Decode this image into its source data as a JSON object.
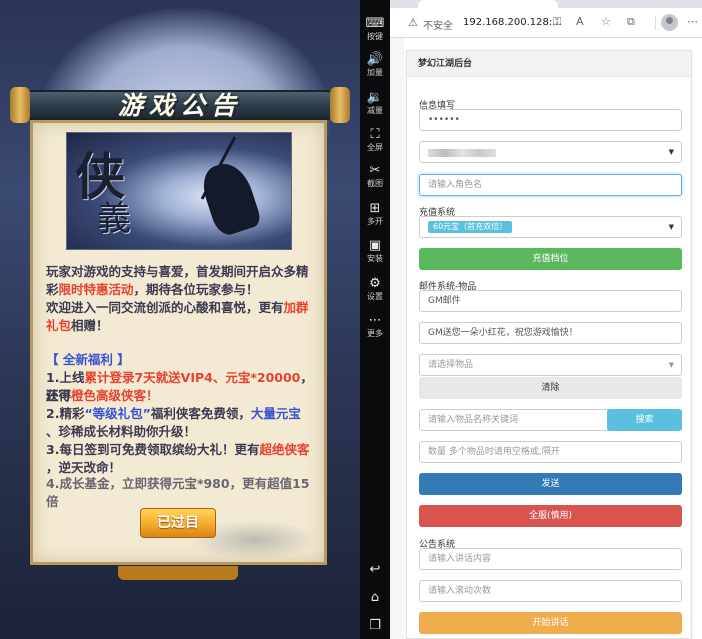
{
  "game": {
    "notice_title": "游戏公告",
    "banner_chars": [
      "侠",
      "義"
    ],
    "intro_lines": [
      "玩家对游戏的支持与喜爱，首发期间开启众多精",
      "彩",
      "限时特惠活动",
      "，期待各位玩家参与！",
      "欢迎进入一同交流创派的心酸和喜悦，更有",
      "加群",
      "礼包",
      "相赠！"
    ],
    "welfare_title": "【 全新福利 】",
    "welfare_1a": "1.上线",
    "welfare_1b": "累计登录7天就送VIP4、元宝*20000",
    "welfare_1c": "，还可",
    "welfare_1d": "获得",
    "welfare_1e": "橙色高级侠客！",
    "welfare_2a": "2.精彩",
    "welfare_2b": "“等级礼包”",
    "welfare_2c": "福利侠客免费领，",
    "welfare_2d": "大量元宝",
    "welfare_2e": "、珍稀成长材料助你升级！",
    "welfare_3a": "3.每日签到可免费领取缤纷大礼！更有",
    "welfare_3b": "超绝侠客",
    "welfare_3c": "，逆天改命！",
    "welfare_4": "4.成长基金，立即获得元宝*980，更有超值15倍",
    "done_button": "已过目"
  },
  "toolbar": {
    "items": [
      {
        "icon": "keyboard-icon",
        "glyph": "⌨",
        "label": "按键"
      },
      {
        "icon": "volume-up-icon",
        "glyph": "🔊",
        "label": "加量"
      },
      {
        "icon": "volume-down-icon",
        "glyph": "🔉",
        "label": "减量"
      },
      {
        "icon": "fullscreen-icon",
        "glyph": "⛶",
        "label": "全屏"
      },
      {
        "icon": "scissors-icon",
        "glyph": "✂",
        "label": "截图"
      },
      {
        "icon": "multi-open-icon",
        "glyph": "⊞",
        "label": "多开"
      },
      {
        "icon": "apk-install-icon",
        "glyph": "▣",
        "label": "安装"
      },
      {
        "icon": "settings-gear-icon",
        "glyph": "⚙",
        "label": "设置"
      },
      {
        "icon": "more-icon",
        "glyph": "⋯",
        "label": "更多"
      }
    ],
    "nav": [
      {
        "icon": "back-icon",
        "glyph": "↩"
      },
      {
        "icon": "home-icon",
        "glyph": "⌂"
      },
      {
        "icon": "recent-apps-icon",
        "glyph": "❐"
      }
    ]
  },
  "browser": {
    "tab_title": "梦幻江湖后台",
    "insecure_label": "不安全",
    "url": "192.168.200.128:...",
    "panel_title": "梦幻江湖后台",
    "info_label": "信息填写",
    "password_value": "••••••",
    "role_placeholder": "请输入角色名",
    "recharge_label": "充值系统",
    "recharge_option": "60元宝（首充双倍）",
    "recharge_button": "充值档位",
    "mail_label": "邮件系统-物品",
    "mail_sender": "GM邮件",
    "mail_message": "GM送您一朵小红花，祝您游戏愉快！",
    "item_select_placeholder": "请选择物品",
    "clear_button": "清除",
    "item_search_placeholder": "请输入物品名称关键词",
    "search_button": "搜索",
    "quantity_placeholder": "数量 多个物品时请用空格或,隔开",
    "send_button": "发送",
    "send_all_button": "全服(慎用)",
    "notice_label": "公告系统",
    "notice_content_placeholder": "请输入讲话内容",
    "scroll_count_placeholder": "请输入滚动次数",
    "start_speech_button": "开始讲话"
  },
  "colors": {
    "green": "#5cb85c",
    "cyan": "#5bc0de",
    "navy": "#337ab7",
    "danger": "#d9534f",
    "orange": "#f0ad4e"
  }
}
